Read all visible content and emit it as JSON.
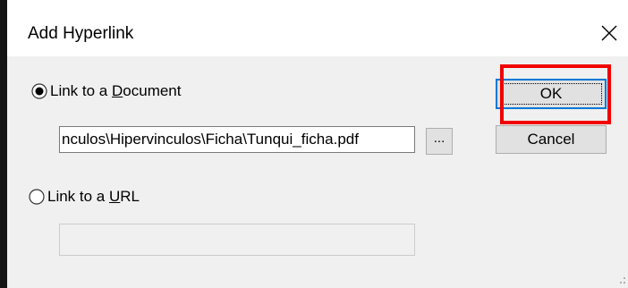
{
  "dialog": {
    "title": "Add Hyperlink",
    "close_icon": "close-icon"
  },
  "options": {
    "document": {
      "label_pre": "Link to a ",
      "label_mnemonic": "D",
      "label_post": "ocument",
      "selected": true
    },
    "url": {
      "label_pre": "Link to a ",
      "label_mnemonic": "U",
      "label_post": "RL",
      "selected": false
    }
  },
  "document_path": {
    "value": "nculos\\Hipervinculos\\Ficha\\Tunqui_ficha.pdf"
  },
  "browse_button": {
    "label": "..."
  },
  "url_field": {
    "value": ""
  },
  "buttons": {
    "ok_label": "OK",
    "cancel_label": "Cancel"
  },
  "colors": {
    "highlight": "#f00000",
    "focus_border": "#0078d7"
  }
}
